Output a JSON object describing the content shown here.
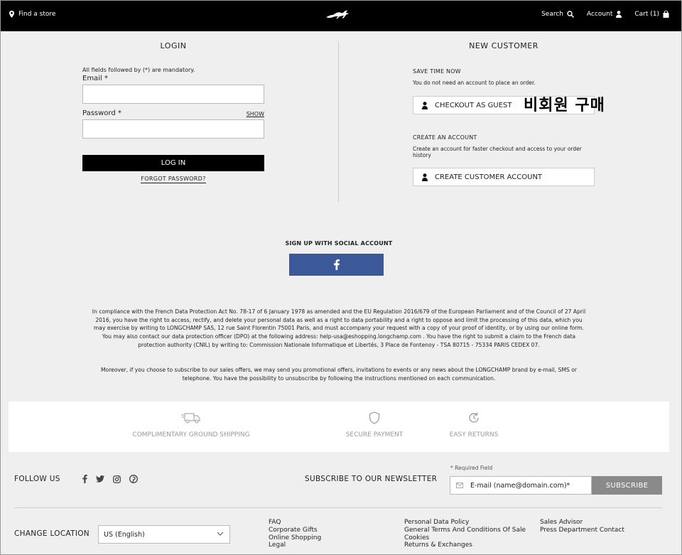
{
  "header": {
    "find_store": "Find a store",
    "search": "Search",
    "account": "Account",
    "cart": "Cart (1)"
  },
  "login": {
    "title": "LOGIN",
    "note": "All fields followed by (*) are mandatory.",
    "email_label": "Email *",
    "email_value": "",
    "password_label": "Password *",
    "password_value": "",
    "show": "SHOW",
    "login_button": "LOG IN",
    "forgot": "FORGOT PASSWORD?"
  },
  "new_customer": {
    "title": "NEW CUSTOMER",
    "save_time_title": "SAVE TIME NOW",
    "save_time_text": "You do not need an account to place an order.",
    "guest_button": "CHECKOUT AS GUEST",
    "guest_annotation": "비회원 구매",
    "create_title": "CREATE AN ACCOUNT",
    "create_text": "Create an account for faster checkout and access to your order history",
    "create_button": "CREATE CUSTOMER ACCOUNT"
  },
  "social": {
    "title": "SIGN UP WITH SOCIAL ACCOUNT",
    "facebook_icon": "facebook-icon"
  },
  "legal": {
    "paragraph1": "In compliance with the French Data Protection Act No. 78-17 of 6 January 1978 as amended and the EU Regulation 2016/679 of the European Parliament and of the Council of 27 April 2016, you have the right to access, rectify, and delete your personal data as well as a right to data portability and a right to oppose and limit the processing of this data, which you may exercise by writing to LONGCHAMP SAS, 12 rue Saint Florentin 75001 Paris, and must accompany your request with a copy of your proof of identity, or by using our online form. You may also contact our data protection officer (DPO) at the following address: help-usa@eshopping.longchamp.com . You have the right to submit a claim to the French data protection authority (CNIL) by writing to: Commission Nationale Informatique et Libertés, 3 Place de Fontenoy - TSA 80715 - 75334 PARIS CEDEX 07.",
    "paragraph2": "Moreover, if you choose to subscribe to our sales offers, we may send you promotional offers, invitations to events or any news about the LONGCHAMP brand by e-mail, SMS or telephone. You have the possibility to unsubscribe by following the instructions mentioned on each communication."
  },
  "features": [
    {
      "label": "COMPLIMENTARY GROUND SHIPPING",
      "icon": "truck-icon"
    },
    {
      "label": "SECURE PAYMENT",
      "icon": "shield-icon"
    },
    {
      "label": "EASY RETURNS",
      "icon": "return-icon"
    }
  ],
  "footer": {
    "follow_us": "FOLLOW US",
    "newsletter_title": "SUBSCRIBE TO OUR NEWSLETTER",
    "required_field": "* Required Field",
    "newsletter_placeholder": "E-mail (name@domain.com)*",
    "subscribe": "SUBSCRIBE",
    "change_location": "CHANGE LOCATION",
    "location_value": "US (English)",
    "links_col1": [
      "FAQ",
      "Corporate Gifts",
      "Online Shopping",
      "Legal"
    ],
    "links_col2": [
      "Personal Data Policy",
      "General Terms And Conditions Of Sale",
      "Cookies",
      "Returns & Exchanges"
    ],
    "links_col3": [
      "Sales Advisor",
      "Press Department Contact"
    ]
  }
}
